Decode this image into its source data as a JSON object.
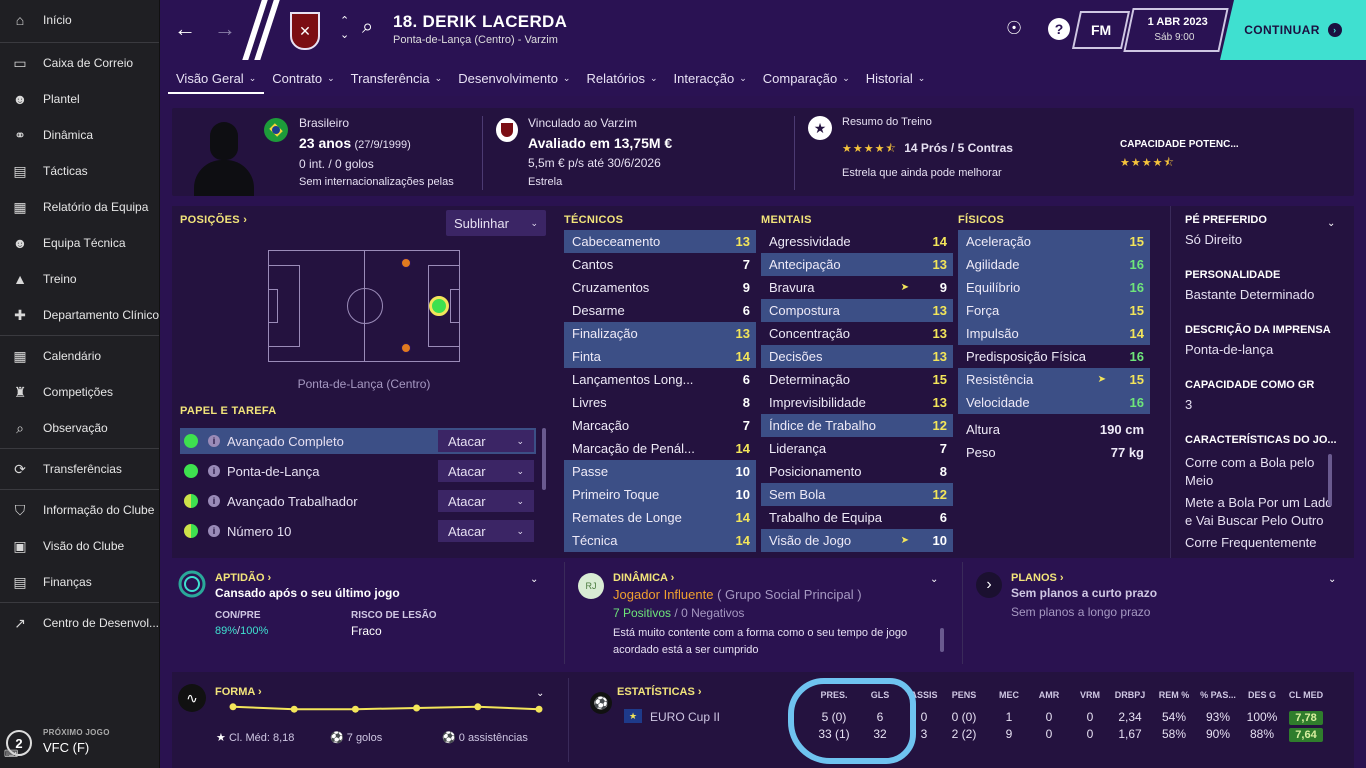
{
  "sidebar": {
    "items": [
      {
        "label": "Início",
        "icon": "home-icon"
      },
      {
        "label": "Caixa de Correio",
        "icon": "inbox-icon"
      },
      {
        "label": "Plantel",
        "icon": "squad-icon"
      },
      {
        "label": "Dinâmica",
        "icon": "dynamics-icon"
      },
      {
        "label": "Tácticas",
        "icon": "tactics-icon"
      },
      {
        "label": "Relatório da Equipa",
        "icon": "report-icon"
      },
      {
        "label": "Equipa Técnica",
        "icon": "staff-icon"
      },
      {
        "label": "Treino",
        "icon": "training-icon"
      },
      {
        "label": "Departamento Clínico",
        "icon": "medical-icon"
      },
      {
        "label": "Calendário",
        "icon": "calendar-icon"
      },
      {
        "label": "Competições",
        "icon": "trophy-icon"
      },
      {
        "label": "Observação",
        "icon": "scouting-icon"
      },
      {
        "label": "Transferências",
        "icon": "transfers-icon"
      },
      {
        "label": "Informação do Clube",
        "icon": "shield-icon"
      },
      {
        "label": "Visão do Clube",
        "icon": "briefcase-icon"
      },
      {
        "label": "Finanças",
        "icon": "finance-icon"
      },
      {
        "label": "Centro de Desenvol...",
        "icon": "development-icon"
      }
    ],
    "next_match": {
      "label": "PRÓXIMO JOGO",
      "value": "VFC (F)",
      "number": "2"
    }
  },
  "header": {
    "player_name": "18. DERIK LACERDA",
    "player_sub": "Ponta-de-Lança (Centro) - Varzim",
    "fm_label": "FM",
    "date": "1 ABR 2023",
    "time": "Sáb 9:00",
    "continue_label": "CONTINUAR"
  },
  "tabs": [
    "Visão Geral",
    "Contrato",
    "Transferência",
    "Desenvolvimento",
    "Relatórios",
    "Interacção",
    "Comparação",
    "Historial"
  ],
  "summary": {
    "nationality": "Brasileiro",
    "age": "23 anos",
    "dob": "(27/9/1999)",
    "caps": "0 int. / 0 golos",
    "intl": "Sem internacionalizações pelas",
    "club": "Vinculado ao Varzim",
    "value": "Avaliado em 13,75M €",
    "wage": "5,5m € p/s até 30/6/2026",
    "status": "Estrela",
    "training_title": "Resumo do Treino",
    "training_stars": "★★★★⯪",
    "training_pros": "14 Prós / 5 Contras",
    "training_note": "Estrela que ainda pode melhorar",
    "potential_title": "CAPACIDADE POTENC...",
    "potential_stars": "★★★★⯪"
  },
  "positions": {
    "title": "POSIÇÕES ›",
    "select_label": "Sublinhar",
    "caption": "Ponta-de-Lança (Centro)"
  },
  "roles": {
    "title": "PAPEL E TAREFA",
    "items": [
      {
        "name": "Avançado Completo",
        "duty": "Atacar"
      },
      {
        "name": "Ponta-de-Lança",
        "duty": "Atacar"
      },
      {
        "name": "Avançado Trabalhador",
        "duty": "Atacar"
      },
      {
        "name": "Número 10",
        "duty": "Atacar"
      }
    ]
  },
  "attributes": {
    "technical": {
      "title": "TÉCNICOS",
      "items": [
        {
          "name": "Cabeceamento",
          "value": "13"
        },
        {
          "name": "Cantos",
          "value": "7"
        },
        {
          "name": "Cruzamentos",
          "value": "9"
        },
        {
          "name": "Desarme",
          "value": "6"
        },
        {
          "name": "Finalização",
          "value": "13"
        },
        {
          "name": "Finta",
          "value": "14"
        },
        {
          "name": "Lançamentos Long...",
          "value": "6"
        },
        {
          "name": "Livres",
          "value": "8"
        },
        {
          "name": "Marcação",
          "value": "7"
        },
        {
          "name": "Marcação de Penál...",
          "value": "14"
        },
        {
          "name": "Passe",
          "value": "10"
        },
        {
          "name": "Primeiro Toque",
          "value": "10"
        },
        {
          "name": "Remates de Longe",
          "value": "14"
        },
        {
          "name": "Técnica",
          "value": "14"
        }
      ]
    },
    "mental": {
      "title": "MENTAIS",
      "items": [
        {
          "name": "Agressividade",
          "value": "14"
        },
        {
          "name": "Antecipação",
          "value": "13"
        },
        {
          "name": "Bravura",
          "value": "9"
        },
        {
          "name": "Compostura",
          "value": "13"
        },
        {
          "name": "Concentração",
          "value": "13"
        },
        {
          "name": "Decisões",
          "value": "13"
        },
        {
          "name": "Determinação",
          "value": "15"
        },
        {
          "name": "Imprevisibilidade",
          "value": "13"
        },
        {
          "name": "Índice de Trabalho",
          "value": "12"
        },
        {
          "name": "Liderança",
          "value": "7"
        },
        {
          "name": "Posicionamento",
          "value": "8"
        },
        {
          "name": "Sem Bola",
          "value": "12"
        },
        {
          "name": "Trabalho de Equipa",
          "value": "6"
        },
        {
          "name": "Visão de Jogo",
          "value": "10"
        }
      ]
    },
    "physical": {
      "title": "FÍSICOS",
      "items": [
        {
          "name": "Aceleração",
          "value": "15"
        },
        {
          "name": "Agilidade",
          "value": "16"
        },
        {
          "name": "Equilíbrio",
          "value": "16"
        },
        {
          "name": "Força",
          "value": "15"
        },
        {
          "name": "Impulsão",
          "value": "14"
        },
        {
          "name": "Predisposição Física",
          "value": "16"
        },
        {
          "name": "Resistência",
          "value": "15"
        },
        {
          "name": "Velocidade",
          "value": "16"
        }
      ],
      "height_label": "Altura",
      "height": "190 cm",
      "weight_label": "Peso",
      "weight": "77 kg"
    }
  },
  "right_info": {
    "foot_title": "PÉ PREFERIDO",
    "foot": "Só Direito",
    "personality_title": "PERSONALIDADE",
    "personality": "Bastante Determinado",
    "press_title": "DESCRIÇÃO DA IMPRENSA",
    "press": "Ponta-de-lança",
    "gk_title": "CAPACIDADE COMO GR",
    "gk": "3",
    "traits_title": "CARACTERÍSTICAS DO JO...",
    "traits": [
      "Corre com a Bola pelo Meio",
      "Mete a Bola Por um Lado e Vai Buscar Pelo Outro",
      "Corre Frequentemente"
    ]
  },
  "fitness": {
    "title": "APTIDÃO ›",
    "subtitle": "Cansado após o seu último jogo",
    "con_label": "CON/PRE",
    "con_value": "89%",
    "pre_value": "100%",
    "risk_label": "RISCO DE LESÃO",
    "risk_value": "Fraco"
  },
  "dynamics": {
    "title": "DINÂMICA ›",
    "avatar": "RJ",
    "role": "Jogador Influente",
    "group": "( Grupo Social Principal )",
    "positives": "7 Positivos",
    "negatives": "0 Negativos",
    "note": "Está muito contente com a forma como o seu tempo de jogo acordado está a ser cumprido"
  },
  "plans": {
    "title": "PLANOS ›",
    "short": "Sem planos a curto prazo",
    "long": "Sem planos a longo prazo"
  },
  "form": {
    "title": "FORMA ›",
    "avg": "Cl. Méd: 8,18",
    "goals": "7 golos",
    "assists": "0 assistências",
    "ratings": [
      8.2,
      8.0,
      8.0,
      8.1,
      8.2,
      8.0
    ]
  },
  "stats": {
    "title": "ESTATÍSTICAS ›",
    "headers": [
      "PRES.",
      "GLS",
      "ASSIS",
      "PENS",
      "MEC",
      "AMR",
      "VRM",
      "DRBPJ",
      "REM %",
      "% PAS...",
      "DES G",
      "CL MED"
    ],
    "rows": [
      {
        "competition": "EURO Cup II",
        "values": [
          "5 (0)",
          "6",
          "0",
          "0 (0)",
          "1",
          "0",
          "0",
          "2,34",
          "54%",
          "93%",
          "100%"
        ],
        "rating": "7,78"
      },
      {
        "competition": "",
        "values": [
          "33 (1)",
          "32",
          "3",
          "2 (2)",
          "9",
          "0",
          "0",
          "1,67",
          "58%",
          "90%",
          "88%"
        ],
        "rating": "7,64"
      }
    ]
  },
  "colors": {
    "accent": "#3fe0d0",
    "yellow": "#f2e47a",
    "highlight_row": "#3c4f86",
    "annotation": "#6fc3f0"
  }
}
